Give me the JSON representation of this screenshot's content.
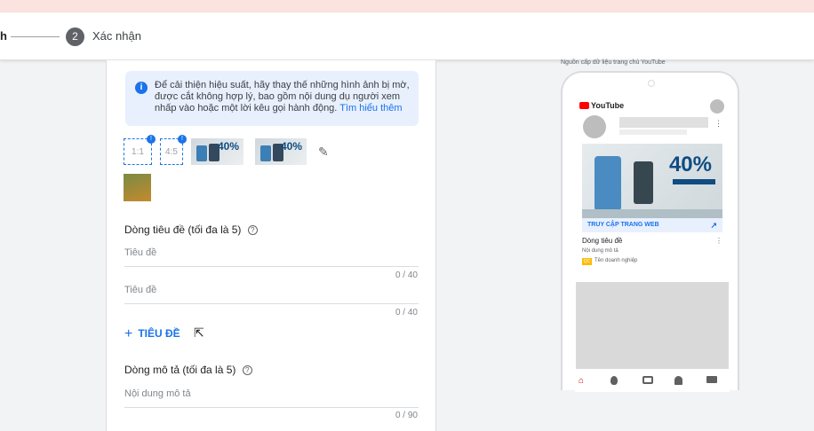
{
  "stepper": {
    "previous_step_fragment": "h",
    "current_step_number": "2",
    "current_step_label": "Xác nhận"
  },
  "info_box": {
    "text": "Để cải thiện hiệu suất, hãy thay thế những hình ảnh bị mờ, được cắt không hợp lý, bao gồm nội dung dụ người xem nhấp vào hoặc một lời kêu gọi hành động.",
    "link": "Tìm hiểu thêm"
  },
  "images": {
    "ratio_1": "1:1",
    "ratio_2": "4:5",
    "badge": "!",
    "thumb_text": "40%"
  },
  "headlines": {
    "title": "Dòng tiêu đề (tối đa là 5)",
    "fields": [
      {
        "placeholder": "Tiêu đề",
        "counter": "0 / 40"
      },
      {
        "placeholder": "Tiêu đề",
        "counter": "0 / 40"
      }
    ],
    "add_label": "TIÊU ĐỀ"
  },
  "descriptions": {
    "title": "Dòng mô tả (tối đa là 5)",
    "fields": [
      {
        "placeholder": "Nội dung mô tả",
        "counter": "0 / 90"
      }
    ]
  },
  "preview": {
    "caption": "Nguồn cấp dữ liệu trang chủ YouTube",
    "youtube_logo": "YouTube",
    "ad_percent": "40%",
    "cta": "TRUY CẬP TRANG WEB",
    "ad_title": "Dòng tiêu đề",
    "ad_description": "Nội dung mô tả",
    "ad_badge": "QC",
    "business_name": "Tên doanh nghiệp"
  },
  "icons": {
    "help": "?",
    "info": "i",
    "edit": "✎",
    "plus": "+",
    "more": "⋮",
    "external": "↗",
    "cursor": "⇱"
  }
}
